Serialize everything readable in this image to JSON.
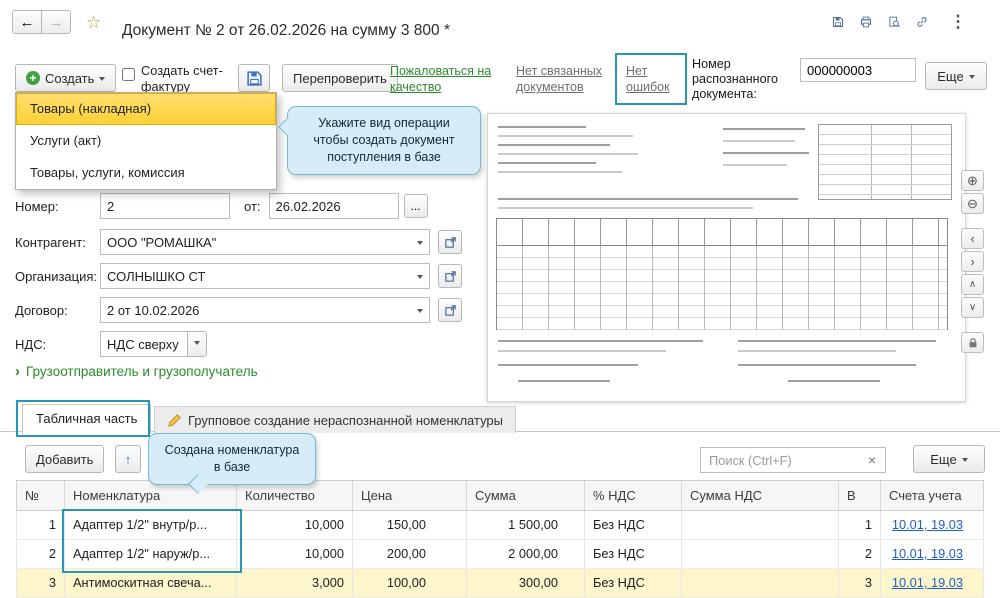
{
  "colors": {
    "annotation": "#2796b4",
    "menu_selected": "#ffd034",
    "green_link": "#2e8b2e",
    "gray_link": "#6f6f6f",
    "account_link": "#1f5fc4",
    "active_row": "#fdf5cc",
    "tooltip_bg": "#d6ecf8"
  },
  "header": {
    "title": "Документ № 2 от 26.02.2026 на сумму 3 800 *"
  },
  "toolbar": {
    "create": "Создать",
    "create_invoice": "Создать счет-фактуру",
    "recheck": "Перепроверить",
    "complain": "Пожаловаться на качество",
    "no_linked_docs": "Нет связанных документов",
    "no_errors": "Нет ошибок",
    "recognized_number_label": "Номер распознанного документа:",
    "recognized_number_value": "000000003",
    "more": "Еще"
  },
  "create_menu": {
    "items": [
      "Товары (накладная)",
      "Услуги (акт)",
      "Товары, услуги, комиссия"
    ]
  },
  "callouts": {
    "operation_hint": "Укажите вид операции чтобы создать документ поступления в базе",
    "created_hint": "Создана номенклатура в базе"
  },
  "form": {
    "number_label": "Номер:",
    "number_value": "2",
    "date_label": "от:",
    "date_value": "26.02.2026",
    "counterparty_label": "Контрагент:",
    "counterparty_value": "ООО \"РОМАШКА\"",
    "organization_label": "Организация:",
    "organization_value": "СОЛНЫШКО СТ",
    "contract_label": "Договор:",
    "contract_value": "2 от 10.02.2026",
    "vat_label": "НДС:",
    "vat_value": "НДС сверху",
    "consignor_link": "Грузоотправитель и грузополучатель"
  },
  "tabs": {
    "tabular": "Табличная часть",
    "group_creation": "Групповое создание нераспознанной номенклатуры"
  },
  "table_toolbar": {
    "add": "Добавить",
    "search_placeholder": "Поиск (Ctrl+F)",
    "more": "Еще"
  },
  "table": {
    "columns": [
      "№",
      "Номенклатура",
      "Количество",
      "Цена",
      "Сумма",
      "% НДС",
      "Сумма НДС",
      "В",
      "Счета учета"
    ],
    "rows": [
      {
        "num": "1",
        "name": "Адаптер 1/2\" внутр/р...",
        "qty": "10,000",
        "price": "150,00",
        "sum": "1 500,00",
        "vat": "Без НДС",
        "vat_sum": "",
        "v": "1",
        "accounts": "10.01, 19.03"
      },
      {
        "num": "2",
        "name": "Адаптер 1/2\" наруж/р...",
        "qty": "10,000",
        "price": "200,00",
        "sum": "2 000,00",
        "vat": "Без НДС",
        "vat_sum": "",
        "v": "2",
        "accounts": "10.01, 19.03"
      },
      {
        "num": "3",
        "name": "Антимоскитная свеча...",
        "qty": "3,000",
        "price": "100,00",
        "sum": "300,00",
        "vat": "Без НДС",
        "vat_sum": "",
        "v": "3",
        "accounts": "10.01, 19.03"
      }
    ]
  },
  "icons": {
    "back": "←",
    "forward": "→",
    "star": "☆",
    "more_vertical": "⋮",
    "plus": "+",
    "zoom_in": "⊕",
    "zoom_out": "⊖",
    "page_prev": "‹",
    "page_next": "›",
    "scroll_up": "∧",
    "scroll_down": "∨",
    "move_up": "↑",
    "clear": "×",
    "ellipsis": "...",
    "group_expand": "›"
  }
}
